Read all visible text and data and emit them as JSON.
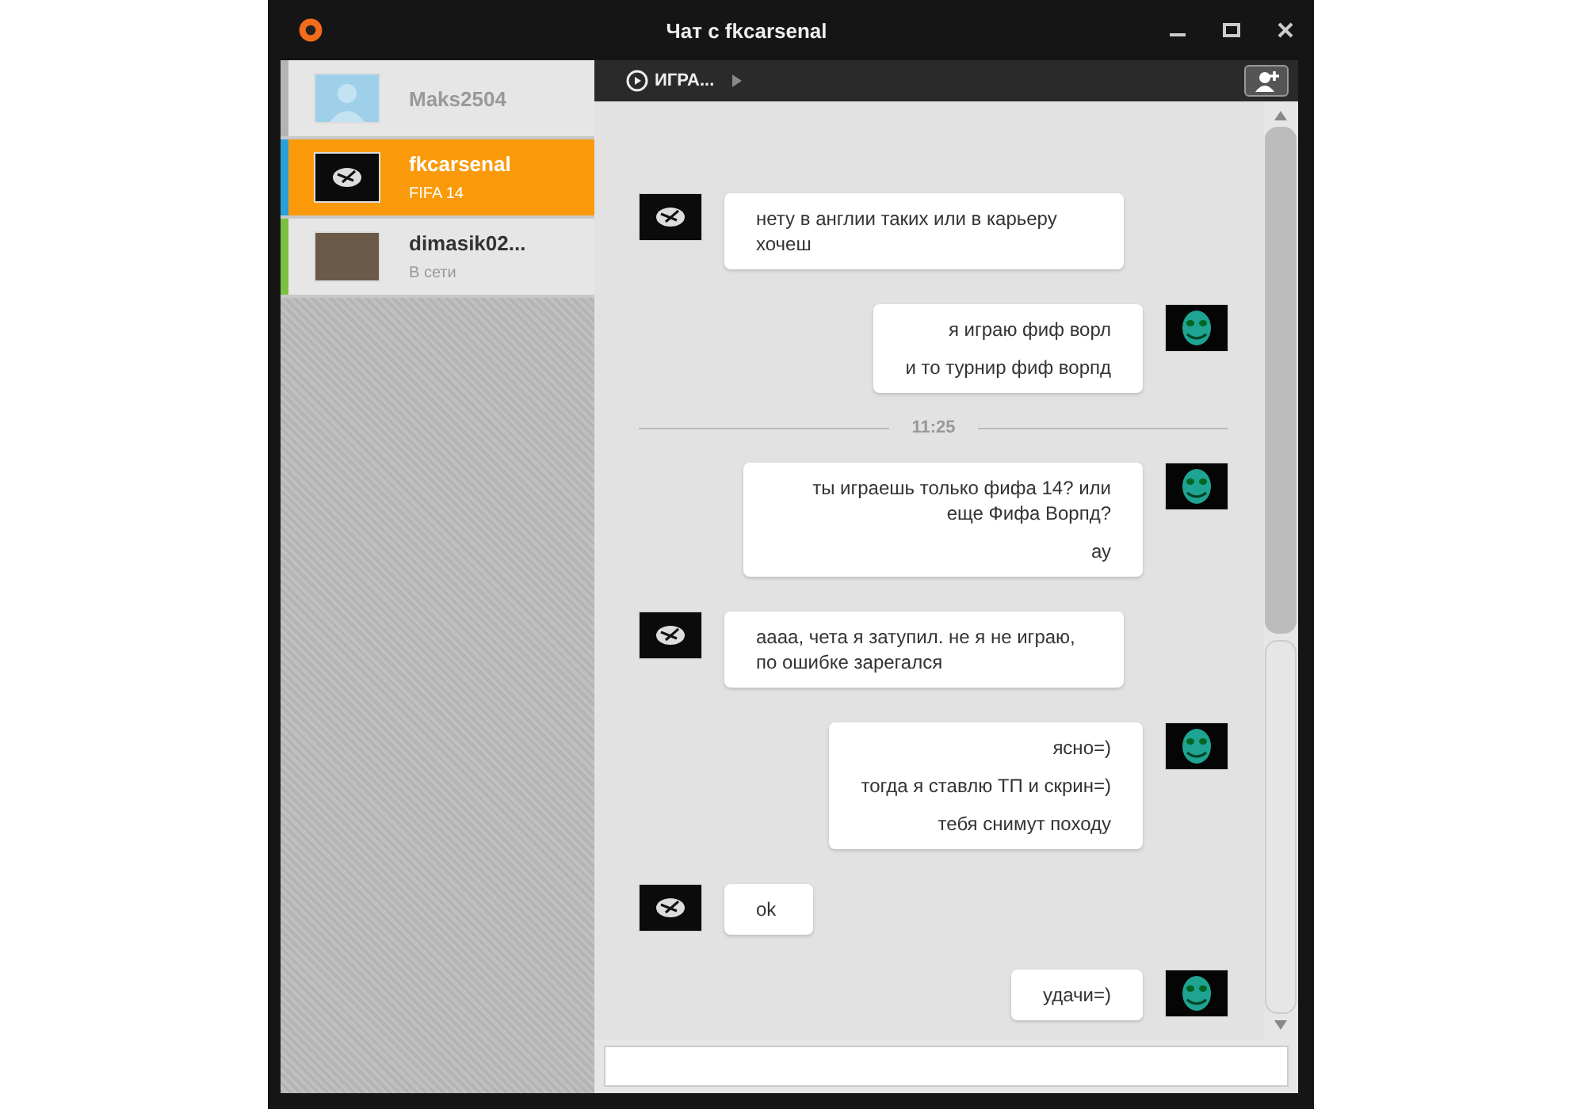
{
  "window": {
    "title": "Чат с fkcarsenal"
  },
  "contacts": [
    {
      "name": "Maks2504",
      "selected": false,
      "color": "#b4b4b4",
      "kind": "placeholder"
    },
    {
      "name": "fkcarsenal",
      "status": "FIFA 14",
      "selected": true,
      "color": "#2a9fd8",
      "kind": "dark"
    },
    {
      "name": "dimasik02...",
      "status": "В сети",
      "selected": false,
      "color": "#7ac143",
      "kind": "photo"
    }
  ],
  "toolbar": {
    "playing_label": "ИГРА..."
  },
  "messages": [
    {
      "kind": "in",
      "lines": [
        "нету в англии таких или в карьеру хочеш"
      ]
    },
    {
      "kind": "out",
      "lines": [
        "я играю фиф ворл",
        "и то турнир фиф ворпд"
      ]
    },
    {
      "kind": "time",
      "lines": [
        "11:25"
      ]
    },
    {
      "kind": "out",
      "lines": [
        "ты играешь только фифа 14? или еще Фифа Ворпд?",
        "ау"
      ]
    },
    {
      "kind": "in",
      "lines": [
        "аааа, чета я затупил. не я не играю, по ошибке зарегался"
      ]
    },
    {
      "kind": "out",
      "lines": [
        "ясно=)",
        "тогда я ставлю ТП и скрин=)",
        "тебя снимут походу"
      ]
    },
    {
      "kind": "in",
      "lines": [
        "ok"
      ]
    },
    {
      "kind": "out",
      "lines": [
        "удачи=)"
      ]
    }
  ]
}
